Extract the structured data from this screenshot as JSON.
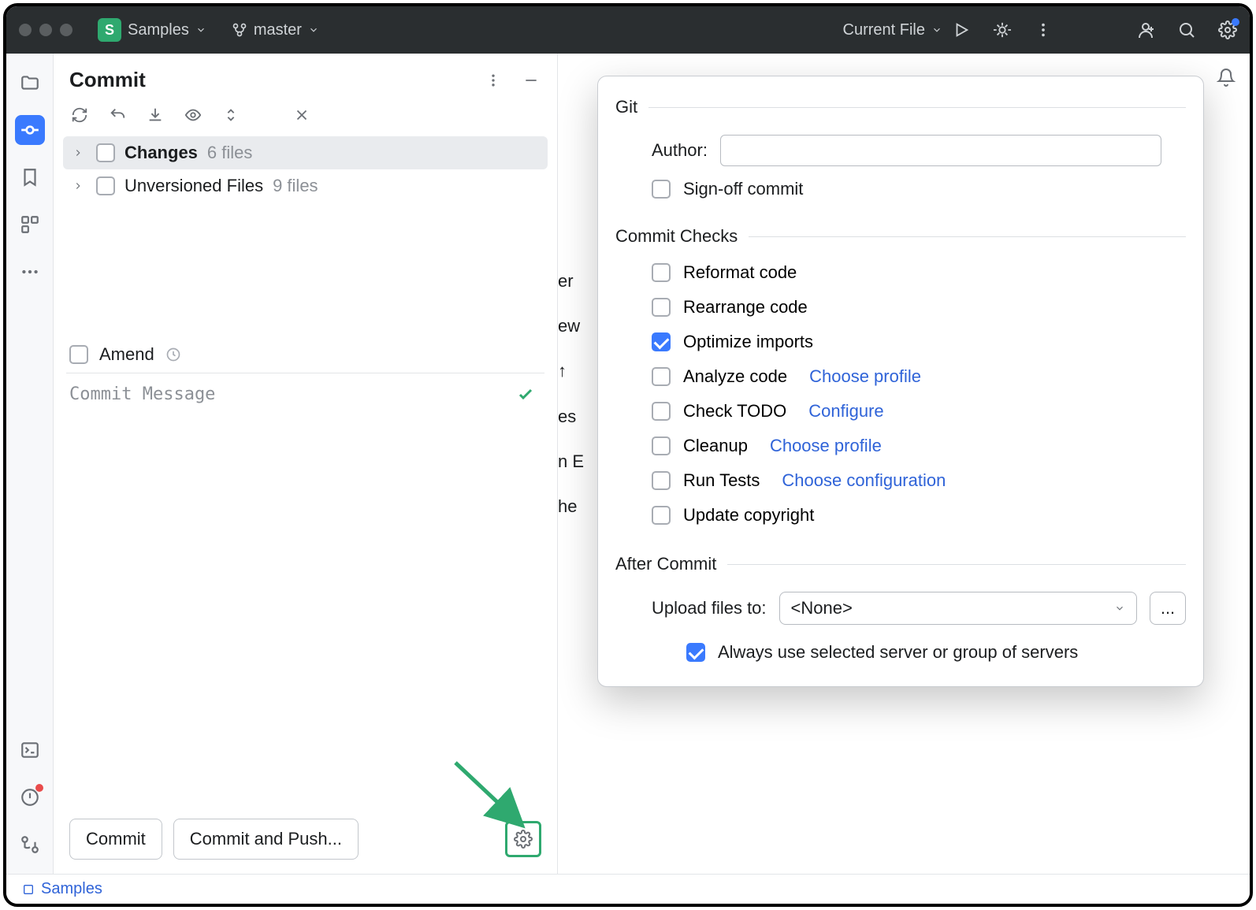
{
  "titlebar": {
    "project_initial": "S",
    "project_name": "Samples",
    "branch": "master",
    "run_target": "Current File"
  },
  "commit_panel": {
    "title": "Commit",
    "changes_label": "Changes",
    "changes_count": "6 files",
    "unversioned_label": "Unversioned Files",
    "unversioned_count": "9 files",
    "amend_label": "Amend",
    "commit_msg_placeholder": "Commit Message",
    "commit_btn": "Commit",
    "commit_push_btn": "Commit and Push..."
  },
  "editor_peek": [
    "er",
    "ew",
    "es",
    "n E",
    "he"
  ],
  "popup": {
    "git_section": "Git",
    "author_label": "Author:",
    "author_value": "",
    "signoff_label": "Sign-off commit",
    "signoff_checked": false,
    "checks_section": "Commit Checks",
    "checks": [
      {
        "key": "reformat",
        "label": "Reformat code",
        "checked": false
      },
      {
        "key": "rearrange",
        "label": "Rearrange code",
        "checked": false
      },
      {
        "key": "optimize",
        "label": "Optimize imports",
        "checked": true
      },
      {
        "key": "analyze",
        "label": "Analyze code",
        "checked": false,
        "link": "Choose profile"
      },
      {
        "key": "todo",
        "label": "Check TODO",
        "checked": false,
        "link": "Configure"
      },
      {
        "key": "cleanup",
        "label": "Cleanup",
        "checked": false,
        "link": "Choose profile"
      },
      {
        "key": "runtests",
        "label": "Run Tests",
        "checked": false,
        "link": "Choose configuration"
      },
      {
        "key": "copyright",
        "label": "Update copyright",
        "checked": false
      }
    ],
    "after_section": "After Commit",
    "upload_label": "Upload files to:",
    "upload_value": "<None>",
    "always_use_label": "Always use selected server or group of servers",
    "always_use_checked": true,
    "more_btn": "..."
  },
  "statusbar": {
    "module": "Samples"
  },
  "editor_arrow_icon": "↑"
}
